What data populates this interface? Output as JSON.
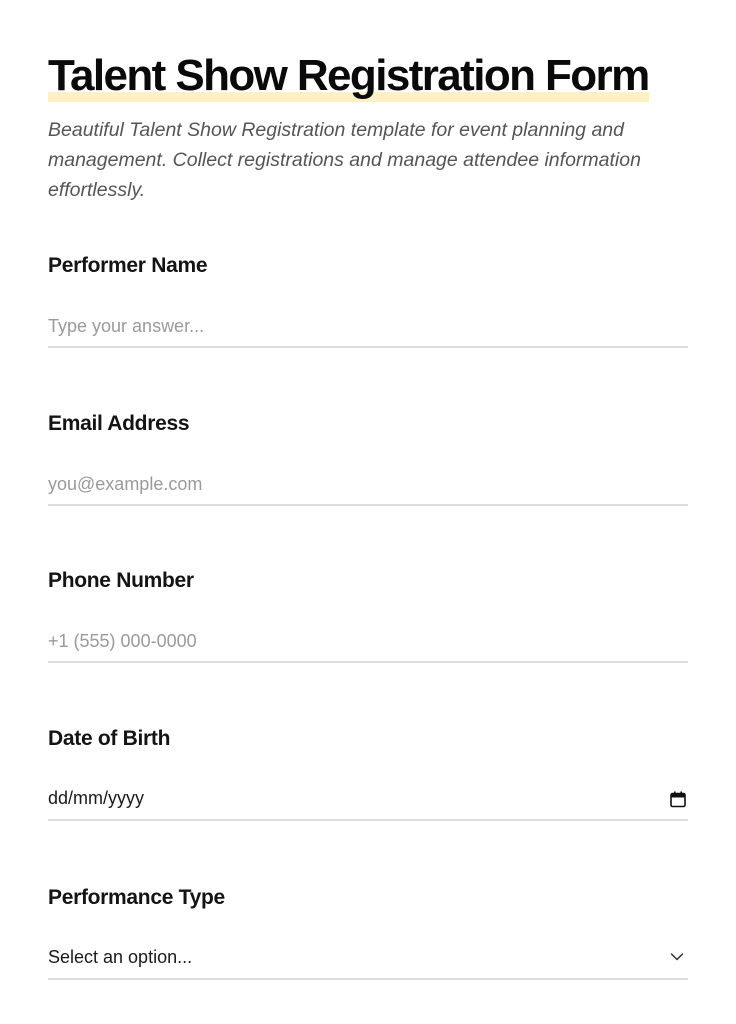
{
  "form": {
    "title": "Talent Show Registration Form",
    "description": "Beautiful Talent Show Registration template for event planning and management. Collect registrations and manage attendee information effortlessly.",
    "highlight_color": "#fdf0c4"
  },
  "fields": {
    "performer_name": {
      "label": "Performer Name",
      "placeholder": "Type your answer..."
    },
    "email": {
      "label": "Email Address",
      "placeholder": "you@example.com"
    },
    "phone": {
      "label": "Phone Number",
      "placeholder": "+1 (555) 000-0000"
    },
    "dob": {
      "label": "Date of Birth",
      "value": "dd/mm/yyyy",
      "icon": "calendar-icon"
    },
    "performance_type": {
      "label": "Performance Type",
      "selected": "Select an option...",
      "icon": "chevron-down-icon"
    }
  }
}
